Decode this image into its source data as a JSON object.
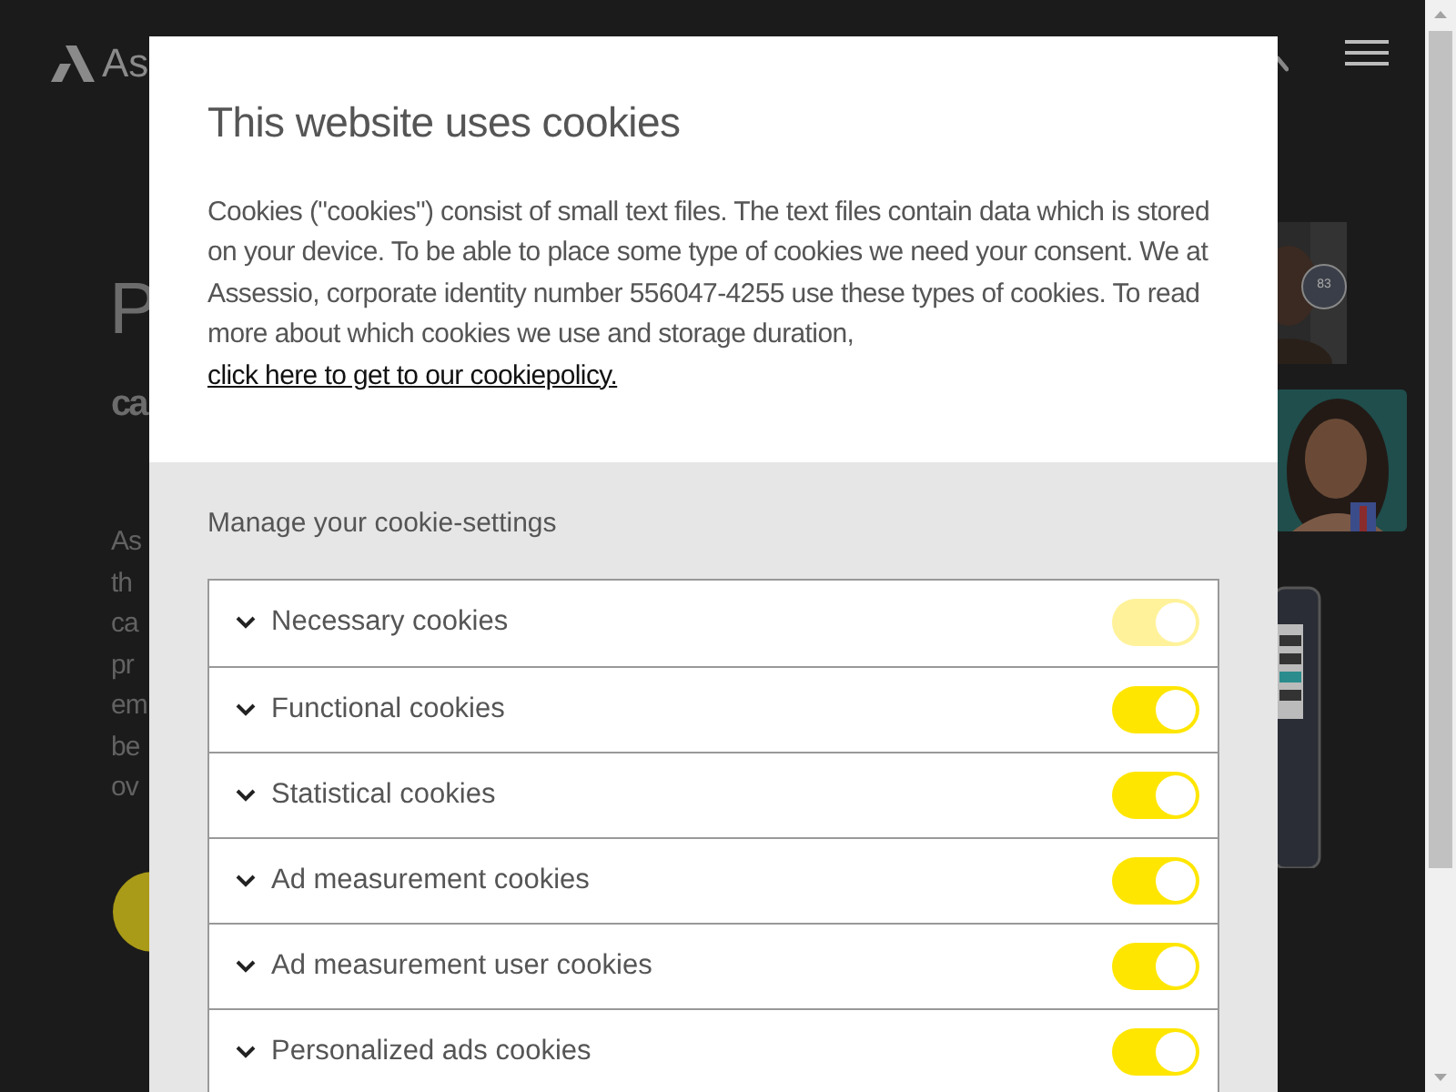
{
  "page": {
    "logo": "As",
    "heading": "P",
    "subheading": "ca",
    "paragraph_lines": [
      "As",
      "th",
      "ca",
      "pr",
      "em",
      "be",
      "ov"
    ],
    "score_badge": "83"
  },
  "dialog": {
    "title": "This website uses cookies",
    "text": "Cookies (\"cookies\") consist of small text files. The text files contain data which is stored on your device. To be able to place some type of cookies we need your consent. We at Assessio, corporate identity number 556047-4255 use these types of cookies. To read more about which cookies we use and storage duration,",
    "link": "click here to get to our cookiepolicy.",
    "settings_heading": "Manage your cookie-settings",
    "categories": [
      {
        "label": "Necessary cookies",
        "expanded": false,
        "on": true,
        "disabled": true
      },
      {
        "label": "Functional cookies",
        "expanded": false,
        "on": true,
        "disabled": false
      },
      {
        "label": "Statistical cookies",
        "expanded": false,
        "on": true,
        "disabled": false
      },
      {
        "label": "Ad measurement cookies",
        "expanded": false,
        "on": true,
        "disabled": false
      },
      {
        "label": "Ad measurement user cookies",
        "expanded": false,
        "on": true,
        "disabled": false
      },
      {
        "label": "Personalized ads cookies",
        "expanded": false,
        "on": true,
        "disabled": false
      }
    ]
  }
}
